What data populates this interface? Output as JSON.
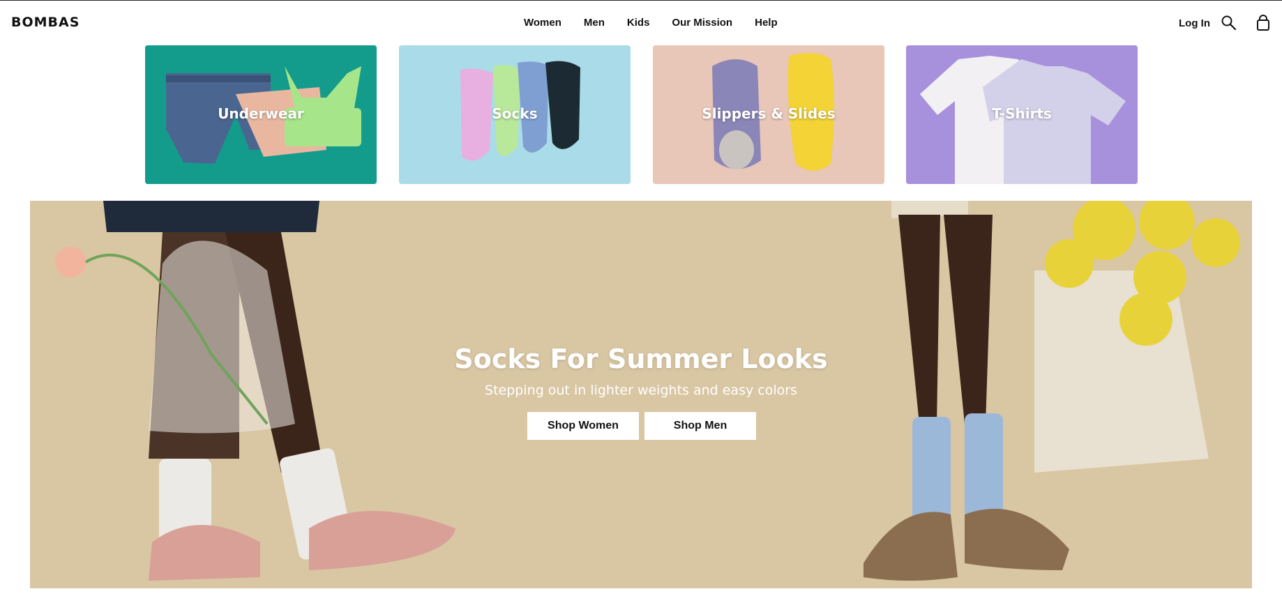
{
  "header": {
    "logo": "BOMBAS",
    "nav": [
      "Women",
      "Men",
      "Kids",
      "Our Mission",
      "Help"
    ],
    "login_label": "Log In",
    "icons": {
      "search": "search-icon",
      "cart": "shopping-bag-icon"
    }
  },
  "categories": [
    {
      "label": "Underwear",
      "color": "#139c8c"
    },
    {
      "label": "Socks",
      "color": "#a9dce8"
    },
    {
      "label": "Slippers & Slides",
      "color": "#e8c6b8"
    },
    {
      "label": "T-Shirts",
      "color": "#a891dc"
    }
  ],
  "hero": {
    "title": "Socks For Summer Looks",
    "subtitle": "Stepping out in lighter weights and easy colors",
    "buttons": {
      "women": "Shop Women",
      "men": "Shop Men"
    },
    "background_color": "#d9c6a3"
  }
}
